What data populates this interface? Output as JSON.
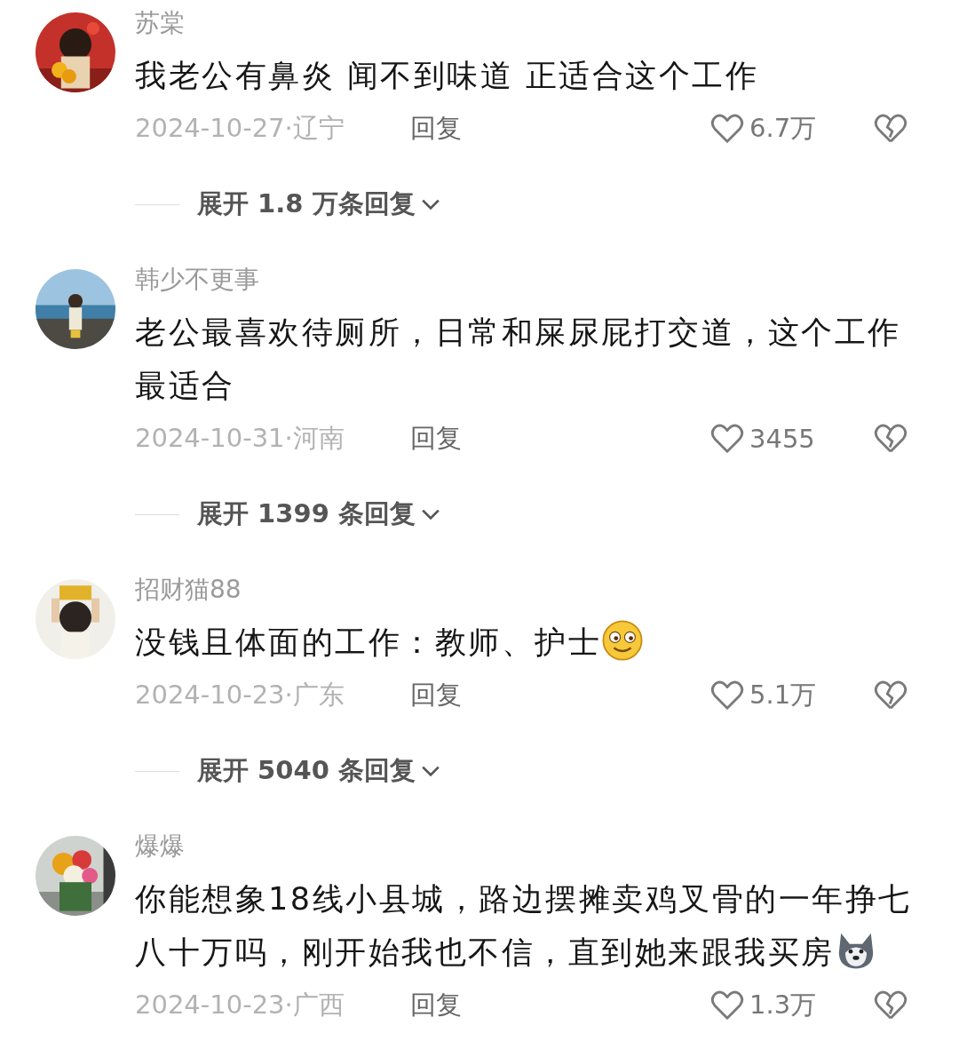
{
  "comments": [
    {
      "kind": "plain",
      "username": "苏棠",
      "text": "我老公有鼻炎 闻不到味道 正适合这个工作",
      "date_location": "2024-10-27·辽宁",
      "reply": "回复",
      "likes": "6.7万",
      "expand": "展开 1.8 万条回复"
    },
    {
      "kind": "plain",
      "username": "韩少不更事",
      "text": "老公最喜欢待厕所，日常和屎尿屁打交道，这个工作最适合",
      "date_location": "2024-10-31·河南",
      "reply": "回复",
      "likes": "3455",
      "expand": "展开 1399 条回复"
    },
    {
      "kind": "smile",
      "username": "招财猫88",
      "text": "没钱且体面的工作：教师、护士",
      "date_location": "2024-10-23·广东",
      "reply": "回复",
      "likes": "5.1万",
      "expand": "展开 5040 条回复"
    },
    {
      "kind": "dog",
      "username": "爆爆",
      "text": "你能想象18线小县城，路边摆摊卖鸡叉骨的一年挣七八十万吗，刚开始我也不信，直到她来跟我买房",
      "date_location": "2024-10-23·广西",
      "reply": "回复",
      "likes": "1.3万"
    }
  ]
}
